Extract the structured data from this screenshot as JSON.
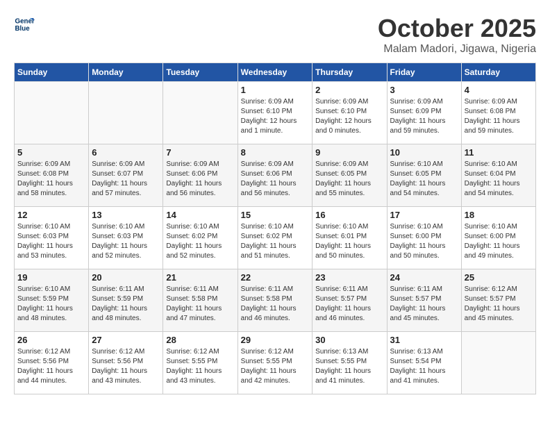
{
  "header": {
    "logo_line1": "General",
    "logo_line2": "Blue",
    "month": "October 2025",
    "location": "Malam Madori, Jigawa, Nigeria"
  },
  "weekdays": [
    "Sunday",
    "Monday",
    "Tuesday",
    "Wednesday",
    "Thursday",
    "Friday",
    "Saturday"
  ],
  "weeks": [
    [
      {
        "day": "",
        "info": ""
      },
      {
        "day": "",
        "info": ""
      },
      {
        "day": "",
        "info": ""
      },
      {
        "day": "1",
        "info": "Sunrise: 6:09 AM\nSunset: 6:10 PM\nDaylight: 12 hours\nand 1 minute."
      },
      {
        "day": "2",
        "info": "Sunrise: 6:09 AM\nSunset: 6:10 PM\nDaylight: 12 hours\nand 0 minutes."
      },
      {
        "day": "3",
        "info": "Sunrise: 6:09 AM\nSunset: 6:09 PM\nDaylight: 11 hours\nand 59 minutes."
      },
      {
        "day": "4",
        "info": "Sunrise: 6:09 AM\nSunset: 6:08 PM\nDaylight: 11 hours\nand 59 minutes."
      }
    ],
    [
      {
        "day": "5",
        "info": "Sunrise: 6:09 AM\nSunset: 6:08 PM\nDaylight: 11 hours\nand 58 minutes."
      },
      {
        "day": "6",
        "info": "Sunrise: 6:09 AM\nSunset: 6:07 PM\nDaylight: 11 hours\nand 57 minutes."
      },
      {
        "day": "7",
        "info": "Sunrise: 6:09 AM\nSunset: 6:06 PM\nDaylight: 11 hours\nand 56 minutes."
      },
      {
        "day": "8",
        "info": "Sunrise: 6:09 AM\nSunset: 6:06 PM\nDaylight: 11 hours\nand 56 minutes."
      },
      {
        "day": "9",
        "info": "Sunrise: 6:09 AM\nSunset: 6:05 PM\nDaylight: 11 hours\nand 55 minutes."
      },
      {
        "day": "10",
        "info": "Sunrise: 6:10 AM\nSunset: 6:05 PM\nDaylight: 11 hours\nand 54 minutes."
      },
      {
        "day": "11",
        "info": "Sunrise: 6:10 AM\nSunset: 6:04 PM\nDaylight: 11 hours\nand 54 minutes."
      }
    ],
    [
      {
        "day": "12",
        "info": "Sunrise: 6:10 AM\nSunset: 6:03 PM\nDaylight: 11 hours\nand 53 minutes."
      },
      {
        "day": "13",
        "info": "Sunrise: 6:10 AM\nSunset: 6:03 PM\nDaylight: 11 hours\nand 52 minutes."
      },
      {
        "day": "14",
        "info": "Sunrise: 6:10 AM\nSunset: 6:02 PM\nDaylight: 11 hours\nand 52 minutes."
      },
      {
        "day": "15",
        "info": "Sunrise: 6:10 AM\nSunset: 6:02 PM\nDaylight: 11 hours\nand 51 minutes."
      },
      {
        "day": "16",
        "info": "Sunrise: 6:10 AM\nSunset: 6:01 PM\nDaylight: 11 hours\nand 50 minutes."
      },
      {
        "day": "17",
        "info": "Sunrise: 6:10 AM\nSunset: 6:00 PM\nDaylight: 11 hours\nand 50 minutes."
      },
      {
        "day": "18",
        "info": "Sunrise: 6:10 AM\nSunset: 6:00 PM\nDaylight: 11 hours\nand 49 minutes."
      }
    ],
    [
      {
        "day": "19",
        "info": "Sunrise: 6:10 AM\nSunset: 5:59 PM\nDaylight: 11 hours\nand 48 minutes."
      },
      {
        "day": "20",
        "info": "Sunrise: 6:11 AM\nSunset: 5:59 PM\nDaylight: 11 hours\nand 48 minutes."
      },
      {
        "day": "21",
        "info": "Sunrise: 6:11 AM\nSunset: 5:58 PM\nDaylight: 11 hours\nand 47 minutes."
      },
      {
        "day": "22",
        "info": "Sunrise: 6:11 AM\nSunset: 5:58 PM\nDaylight: 11 hours\nand 46 minutes."
      },
      {
        "day": "23",
        "info": "Sunrise: 6:11 AM\nSunset: 5:57 PM\nDaylight: 11 hours\nand 46 minutes."
      },
      {
        "day": "24",
        "info": "Sunrise: 6:11 AM\nSunset: 5:57 PM\nDaylight: 11 hours\nand 45 minutes."
      },
      {
        "day": "25",
        "info": "Sunrise: 6:12 AM\nSunset: 5:57 PM\nDaylight: 11 hours\nand 45 minutes."
      }
    ],
    [
      {
        "day": "26",
        "info": "Sunrise: 6:12 AM\nSunset: 5:56 PM\nDaylight: 11 hours\nand 44 minutes."
      },
      {
        "day": "27",
        "info": "Sunrise: 6:12 AM\nSunset: 5:56 PM\nDaylight: 11 hours\nand 43 minutes."
      },
      {
        "day": "28",
        "info": "Sunrise: 6:12 AM\nSunset: 5:55 PM\nDaylight: 11 hours\nand 43 minutes."
      },
      {
        "day": "29",
        "info": "Sunrise: 6:12 AM\nSunset: 5:55 PM\nDaylight: 11 hours\nand 42 minutes."
      },
      {
        "day": "30",
        "info": "Sunrise: 6:13 AM\nSunset: 5:55 PM\nDaylight: 11 hours\nand 41 minutes."
      },
      {
        "day": "31",
        "info": "Sunrise: 6:13 AM\nSunset: 5:54 PM\nDaylight: 11 hours\nand 41 minutes."
      },
      {
        "day": "",
        "info": ""
      }
    ]
  ]
}
